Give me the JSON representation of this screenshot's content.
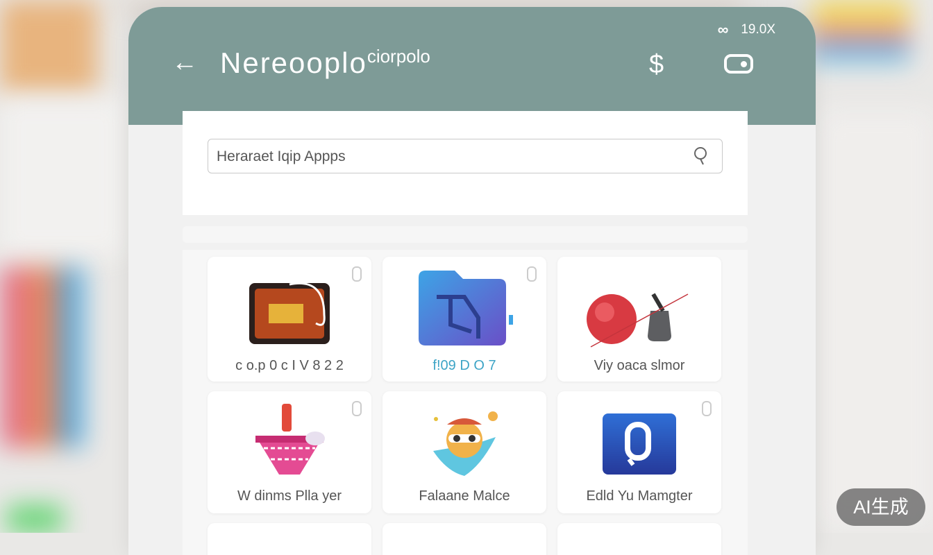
{
  "status": {
    "time": "19.0X",
    "signal_icon": "signal-icon"
  },
  "header": {
    "title": "Nereooplo",
    "title_suffix": "ciorpolo",
    "back_icon": "back-arrow-icon",
    "dollar_icon": "dollar-icon",
    "toggle_icon": "toggle-icon"
  },
  "search": {
    "value": "",
    "placeholder": "Heraraet Iqip Appps",
    "icon": "search-icon"
  },
  "apps": [
    {
      "label": "c o.p 0 c I V 8  2 2",
      "icon": "arcade-icon"
    },
    {
      "label": "f!09 D O 7",
      "icon": "folder-photo-icon"
    },
    {
      "label": "Viy oaca slmor",
      "icon": "boxing-glove-icon"
    },
    {
      "label": "W dinms Plla yer",
      "icon": "music-player-icon"
    },
    {
      "label": "Falaane Malce",
      "icon": "character-game-icon"
    },
    {
      "label": "Edld Yu Mamgter",
      "icon": "file-manager-icon"
    }
  ],
  "watermark": "AI生成",
  "colors": {
    "appbar": "#7e9b97",
    "panel": "#ffffff",
    "background": "#f1f1f1"
  }
}
